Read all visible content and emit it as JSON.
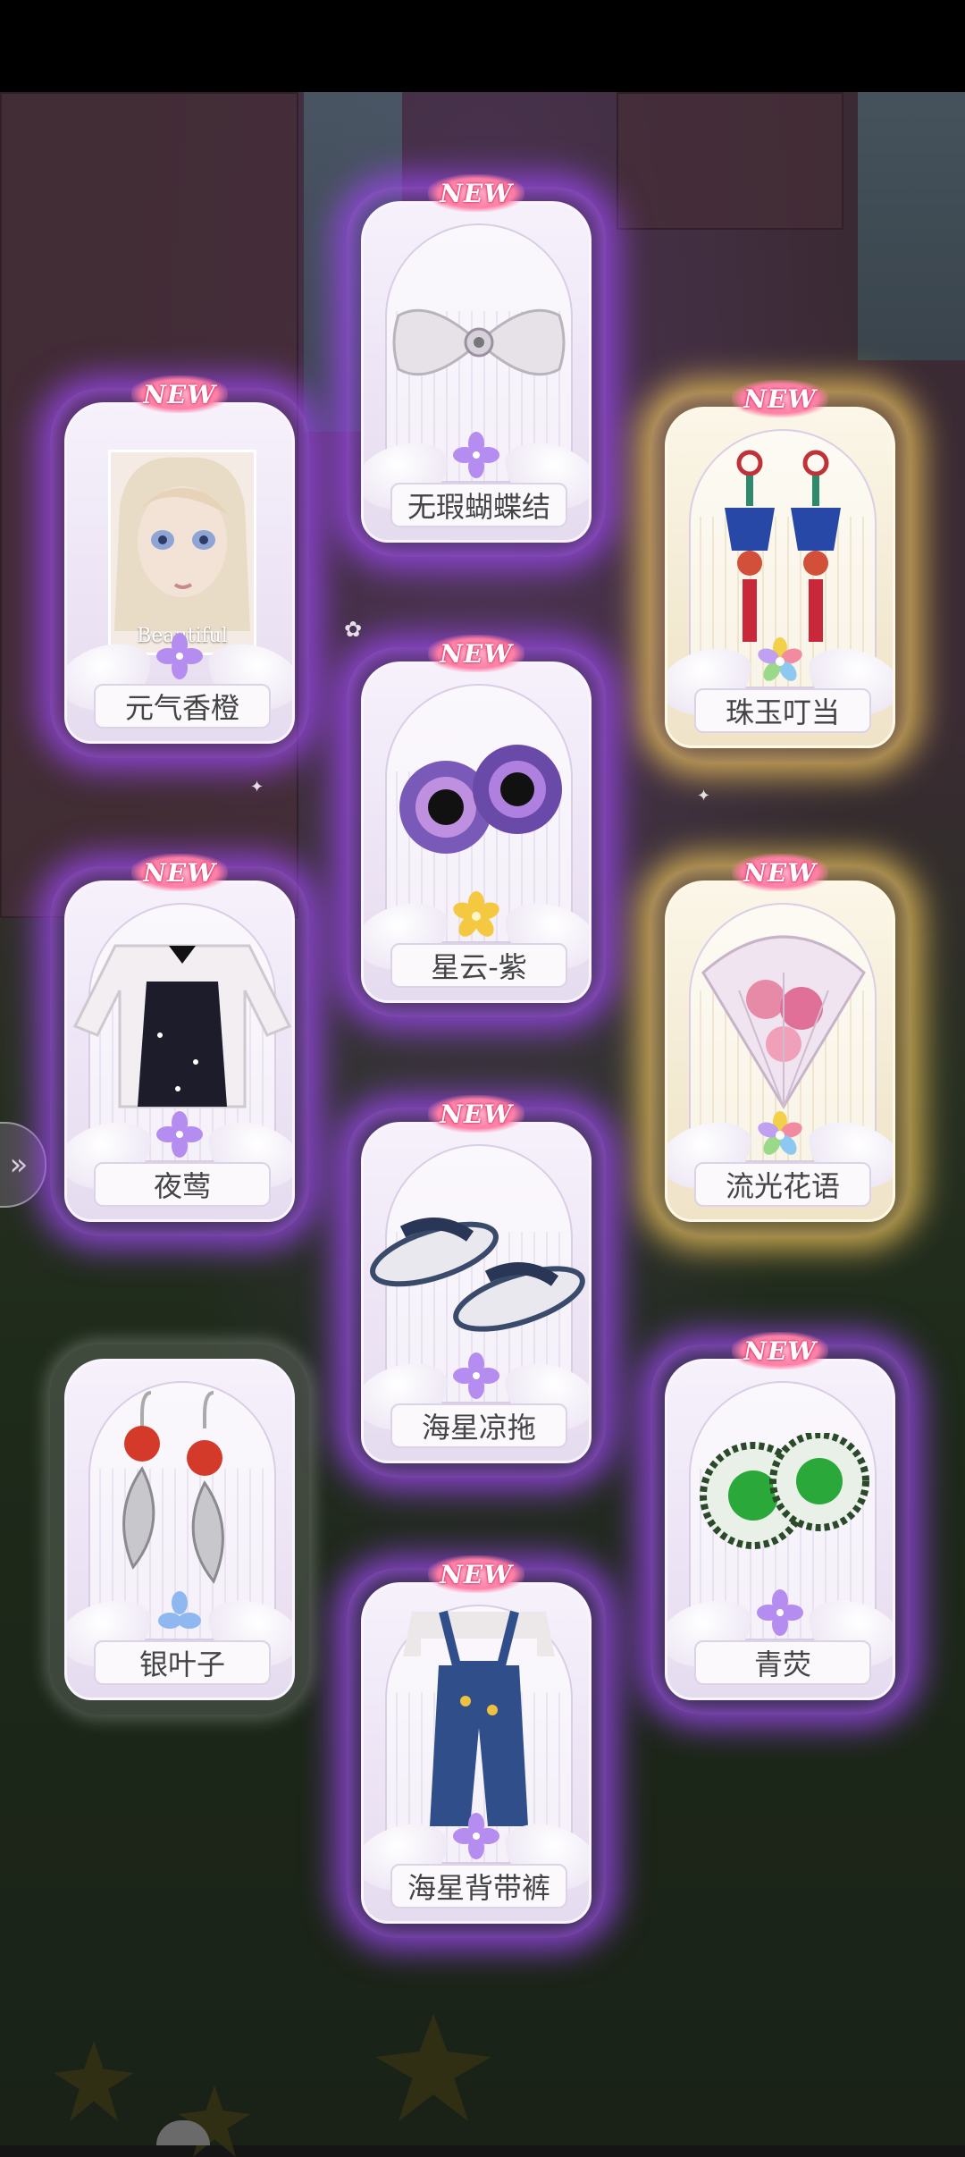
{
  "new_badge": "NEW",
  "cards": [
    {
      "id": "c1",
      "name": "元气香橙",
      "new": true,
      "rarity": "purple",
      "portrait_text": "Beautiful"
    },
    {
      "id": "c2",
      "name": "无瑕蝴蝶结",
      "new": true,
      "rarity": "purple"
    },
    {
      "id": "c3",
      "name": "珠玉叮当",
      "new": true,
      "rarity": "rainbow"
    },
    {
      "id": "c4",
      "name": "星云-紫",
      "new": true,
      "rarity": "gold"
    },
    {
      "id": "c5",
      "name": "夜莺",
      "new": true,
      "rarity": "purple"
    },
    {
      "id": "c6",
      "name": "流光花语",
      "new": true,
      "rarity": "rainbow"
    },
    {
      "id": "c7",
      "name": "海星凉拖",
      "new": true,
      "rarity": "purple"
    },
    {
      "id": "c8",
      "name": "银叶子",
      "new": false,
      "rarity": "blue"
    },
    {
      "id": "c9",
      "name": "青荧",
      "new": true,
      "rarity": "purple"
    },
    {
      "id": "c10",
      "name": "海星背带裤",
      "new": true,
      "rarity": "purple"
    }
  ],
  "colors": {
    "purple_glow": "#9646e6",
    "gold_glow": "#e6be5a",
    "new_pink": "#ff7fa6",
    "rarity_purple": "#b58cf0",
    "rarity_gold": "#f5c842",
    "rarity_blue": "#8fb8f0"
  },
  "icons": {
    "side_button": "chevron-right-icon",
    "rarity": "flower-icon"
  }
}
